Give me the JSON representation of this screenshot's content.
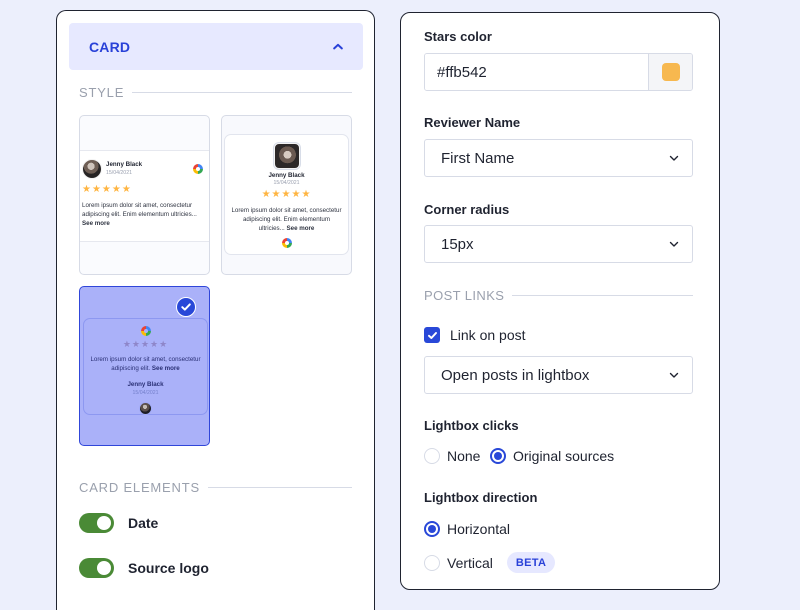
{
  "colors": {
    "accent": "#2948d8",
    "toggle_on": "#4a8a36",
    "star": "#ffb542",
    "selected_card": "#aab1f9"
  },
  "left_panel": {
    "header": {
      "title": "CARD",
      "icon": "chevron-up-icon"
    },
    "style": {
      "label": "STYLE",
      "cards": [
        {
          "name": "Jenny Black",
          "date": "15/04/2021",
          "stars": "★★★★★",
          "text": "Lorem ipsum dolor sit amet, consectetur adipiscing elit. Enim elementum ultricies...",
          "see_more": "See more"
        },
        {
          "name": "Jenny Black",
          "date": "15/04/2021",
          "stars": "★★★★★",
          "text": "Lorem ipsum dolor sit amet, consectetur adipiscing elit. Enim elementum ultricies...",
          "see_more": "See more"
        },
        {
          "name": "Jenny Black",
          "date": "15/04/2021",
          "stars": "★★★★★",
          "text": "Lorem ipsum dolor sit amet, consectetur adipiscing elit.",
          "see_more": "See more",
          "selected": true
        }
      ]
    },
    "card_elements": {
      "label": "CARD ELEMENTS",
      "toggles": [
        {
          "label": "Date",
          "enabled": true
        },
        {
          "label": "Source logo",
          "enabled": true
        }
      ]
    }
  },
  "right_panel": {
    "stars_color": {
      "label": "Stars color",
      "value": "#ffb542"
    },
    "reviewer_name": {
      "label": "Reviewer Name",
      "selected": "First Name"
    },
    "corner_radius": {
      "label": "Corner radius",
      "selected": "15px"
    },
    "post_links": {
      "label": "POST LINKS",
      "link_on_post": "Link on post",
      "link_on_post_checked": true,
      "open_mode": "Open posts in lightbox"
    },
    "lightbox_clicks": {
      "label": "Lightbox clicks",
      "options": [
        "None",
        "Original sources"
      ],
      "selected": "Original sources"
    },
    "lightbox_direction": {
      "label": "Lightbox direction",
      "options": [
        "Horizontal",
        "Vertical"
      ],
      "selected": "Horizontal",
      "beta": "BETA"
    }
  }
}
